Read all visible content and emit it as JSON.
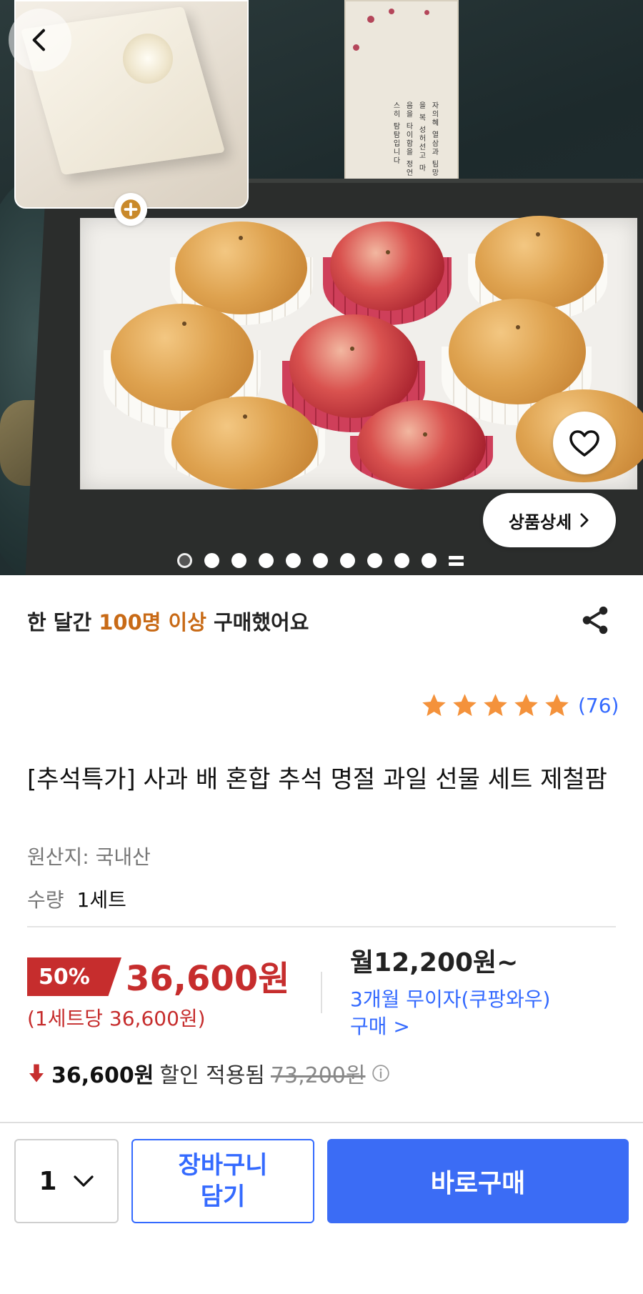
{
  "hero": {
    "card_text": "자의혜 열삼과 팀망을 복 성허선고 마음을 타이함을 정언스히 탐탐입니다",
    "detail_button_label": "상품상세",
    "carousel": {
      "total_dots": 10,
      "active_index": 0,
      "has_more_indicator": true
    }
  },
  "purchase_stat": {
    "prefix": "한 달간 ",
    "highlight": "100명 이상",
    "suffix": " 구매했어요",
    "highlight_color": "#c86a16"
  },
  "rating": {
    "stars": 5,
    "count": "(76)",
    "star_color": "#f4923b"
  },
  "product": {
    "title": "[추석특가] 사과 배 혼합 추석 명절 과일 선물 세트 제철팜",
    "origin": "원산지: 국내산",
    "quantity_label": "수량",
    "quantity_value": "1세트"
  },
  "pricing": {
    "discount_rate": "50%",
    "price": "36,600원",
    "unit_price": "(1세트당 36,600원)",
    "monthly": "월12,200원~",
    "installment": "3개월 무이자(쿠팡와우) 구매 >",
    "discount_amount": "36,600원",
    "discount_applied": "할인 적용됨",
    "original_price": "73,200원",
    "sale_color": "#c62d2d",
    "link_color": "#346aff"
  },
  "bottom_bar": {
    "quantity": "1",
    "cart_label": "장바구니\n담기",
    "buy_label": "바로구매",
    "accent": "#3b6cf5"
  }
}
